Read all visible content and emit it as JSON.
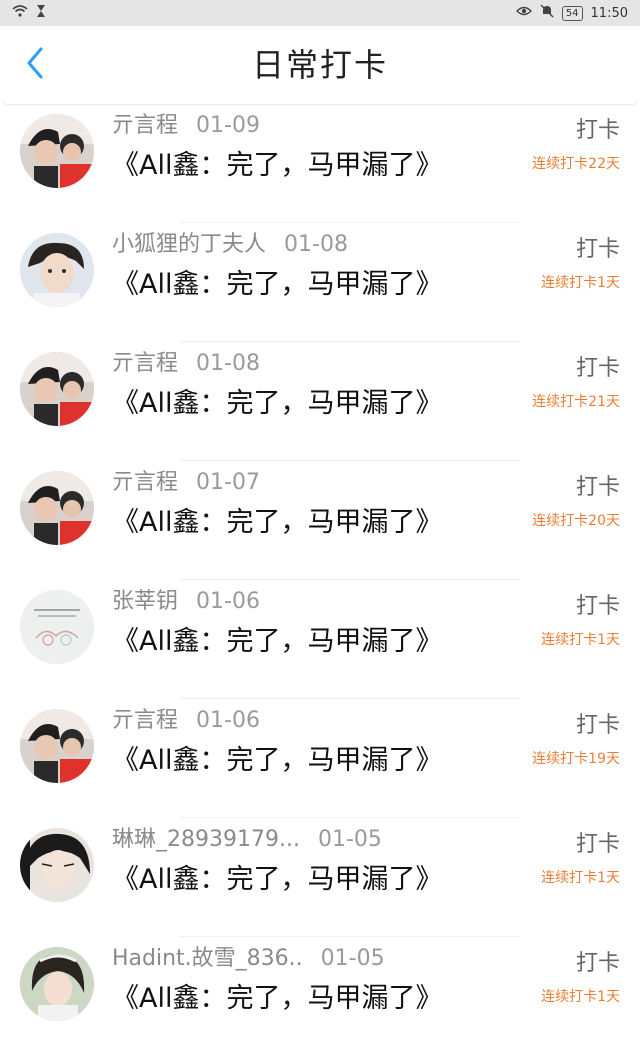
{
  "status_bar": {
    "time": "11:50",
    "battery": "54",
    "icons_left": [
      "wifi-icon",
      "hourglass-icon"
    ],
    "icons_right": [
      "eye-icon",
      "bell-off-icon",
      "battery-icon"
    ]
  },
  "header": {
    "title": "日常打卡",
    "back_icon": "chevron-left-icon",
    "accent_color": "#2e9bff"
  },
  "colors": {
    "streak": "#ee7d34",
    "name": "#8a8a8a",
    "title": "#222222"
  },
  "items": [
    {
      "name": "亓言程",
      "date": "01-09",
      "book": "《All鑫：完了，马甲漏了》",
      "label": "打卡",
      "streak": "连续打卡22天",
      "avatar": "avatar-hat"
    },
    {
      "name": "小狐狸的丁夫人",
      "date": "01-08",
      "book": "《All鑫：完了，马甲漏了》",
      "label": "打卡",
      "streak": "连续打卡1天",
      "avatar": "avatar-boy"
    },
    {
      "name": "亓言程",
      "date": "01-08",
      "book": "《All鑫：完了，马甲漏了》",
      "label": "打卡",
      "streak": "连续打卡21天",
      "avatar": "avatar-hat"
    },
    {
      "name": "亓言程",
      "date": "01-07",
      "book": "《All鑫：完了，马甲漏了》",
      "label": "打卡",
      "streak": "连续打卡20天",
      "avatar": "avatar-hat"
    },
    {
      "name": "张莘钥",
      "date": "01-06",
      "book": "《All鑫：完了，马甲漏了》",
      "label": "打卡",
      "streak": "连续打卡1天",
      "avatar": "avatar-sketch"
    },
    {
      "name": "亓言程",
      "date": "01-06",
      "book": "《All鑫：完了，马甲漏了》",
      "label": "打卡",
      "streak": "连续打卡19天",
      "avatar": "avatar-hat"
    },
    {
      "name": "琳琳_28939179...",
      "date": "01-05",
      "book": "《All鑫：完了，马甲漏了》",
      "label": "打卡",
      "streak": "连续打卡1天",
      "avatar": "avatar-anime"
    },
    {
      "name": "Hadint.故雪_836..",
      "date": "01-05",
      "book": "《All鑫：完了，马甲漏了》",
      "label": "打卡",
      "streak": "连续打卡1天",
      "avatar": "avatar-girl"
    }
  ]
}
